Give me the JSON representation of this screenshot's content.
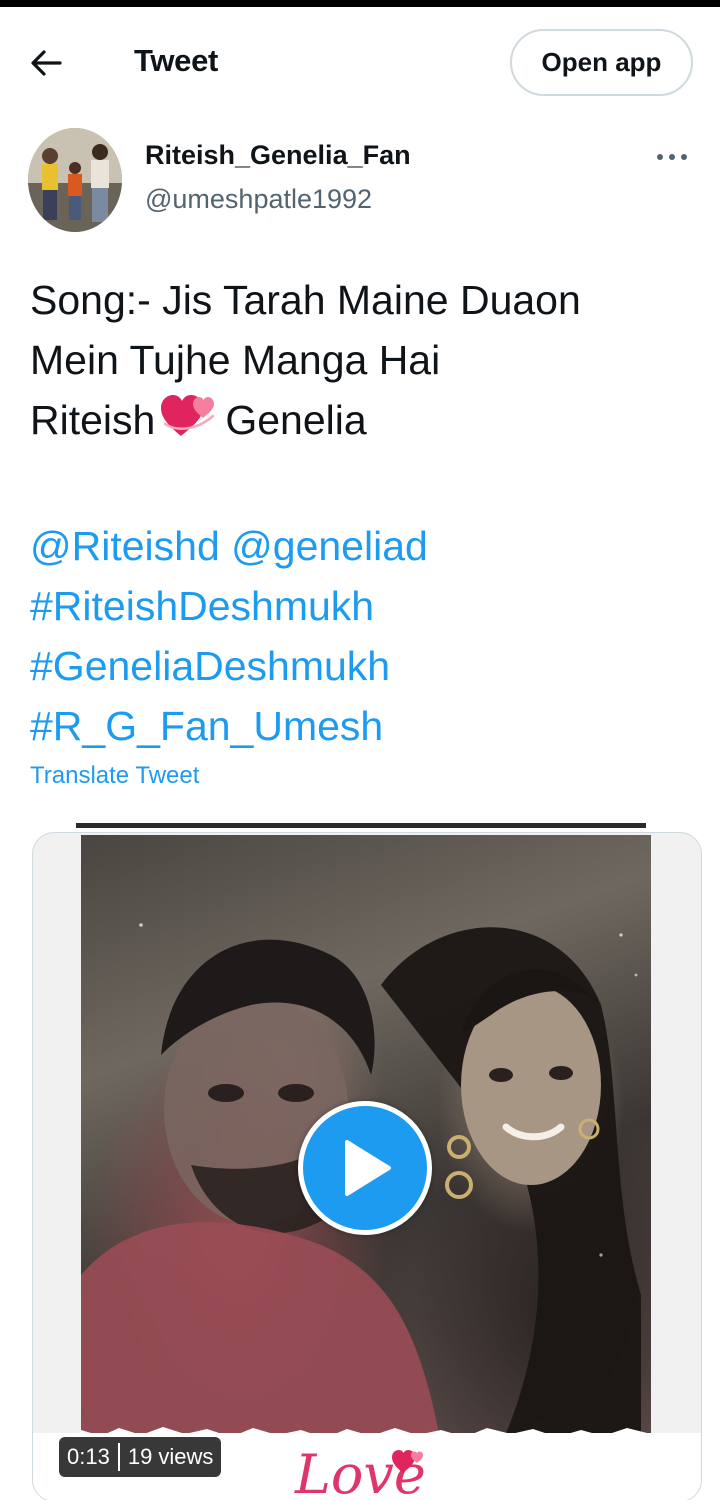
{
  "header": {
    "title": "Tweet",
    "open_app_label": "Open app"
  },
  "author": {
    "display_name": "Riteish_Genelia_Fan",
    "handle": "@umeshpatle1992"
  },
  "tweet": {
    "line1": "Song:- Jis Tarah Maine Duaon",
    "line2": "Mein Tujhe Manga Hai",
    "line3_left": "Riteish",
    "line3_right": "Genelia",
    "mentions": [
      "@Riteishd",
      "@geneliad"
    ],
    "hashtags": [
      "#RiteishDeshmukh",
      "#GeneliaDeshmukh",
      "#R_G_Fan_Umesh"
    ],
    "translate_label": "Translate Tweet"
  },
  "video": {
    "duration": "0:13",
    "views": "19 views",
    "overlay_text": "Love"
  },
  "colors": {
    "link": "#1d9bf0",
    "text": "#0f1419",
    "secondary": "#536471",
    "play": "#1d9bf0"
  },
  "icons": {
    "back": "arrow-left-icon",
    "more": "more-horizontal-icon",
    "heart": "two-hearts-emoji",
    "play": "play-icon"
  }
}
